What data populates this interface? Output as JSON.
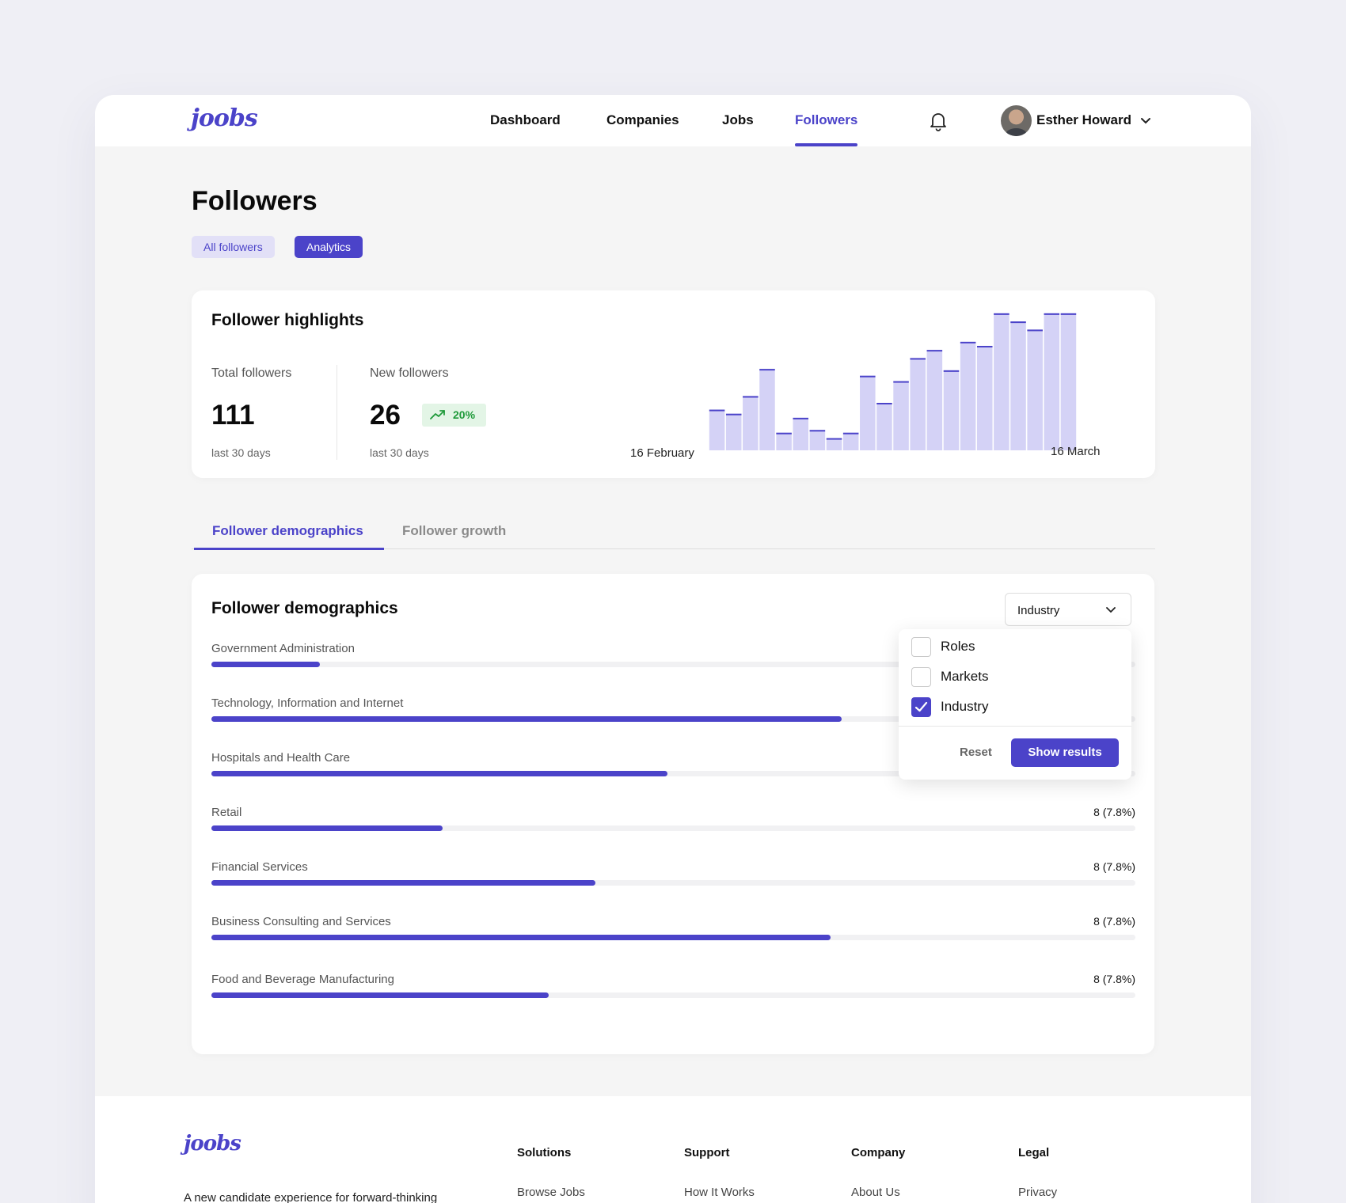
{
  "brand": {
    "name": "joobs",
    "accent": "#4b43c9"
  },
  "nav": {
    "items": [
      "Dashboard",
      "Companies",
      "Jobs",
      "Followers"
    ],
    "active": "Followers"
  },
  "user": {
    "name": "Esther Howard"
  },
  "page": {
    "title": "Followers",
    "pills": {
      "all": "All followers",
      "analytics": "Analytics",
      "active": "Analytics"
    }
  },
  "highlights": {
    "title": "Follower highlights",
    "total": {
      "label": "Total followers",
      "value": "111",
      "sub": "last 30 days"
    },
    "new": {
      "label": "New followers",
      "value": "26",
      "sub": "last 30 days",
      "growth": "20%"
    }
  },
  "chart_data": {
    "type": "bar",
    "x_start_label": "16 February",
    "x_end_label": "16 March",
    "values": [
      30,
      27,
      40,
      60,
      13,
      24,
      15,
      9,
      13,
      55,
      35,
      51,
      68,
      74,
      59,
      80,
      77,
      101,
      95,
      89,
      101,
      101
    ],
    "ylim": [
      0,
      105
    ],
    "grid": false,
    "color": "#d4d2f6",
    "cap_color": "#4b43c9"
  },
  "tabs": {
    "demographics": "Follower demographics",
    "growth": "Follower growth",
    "active": "Follower demographics"
  },
  "demographics": {
    "title": "Follower demographics",
    "filter": "Industry",
    "rows": [
      {
        "label": "Government Administration",
        "value": "",
        "fraction": 0.117
      },
      {
        "label": "Technology, Information and Internet",
        "value": "",
        "fraction": 0.682
      },
      {
        "label": "Hospitals and Health Care",
        "value": "",
        "fraction": 0.494
      },
      {
        "label": "Retail",
        "value": "8 (7.8%)",
        "fraction": 0.25
      },
      {
        "label": "Financial Services",
        "value": "8 (7.8%)",
        "fraction": 0.416
      },
      {
        "label": "Business Consulting and Services",
        "value": "8 (7.8%)",
        "fraction": 0.67
      },
      {
        "label": "Food and Beverage Manufacturing",
        "value": "8 (7.8%)",
        "fraction": 0.365
      }
    ]
  },
  "dropdown": {
    "options": [
      {
        "label": "Roles",
        "checked": false
      },
      {
        "label": "Markets",
        "checked": false
      },
      {
        "label": "Industry",
        "checked": true
      }
    ],
    "reset": "Reset",
    "show": "Show results"
  },
  "footer": {
    "tagline": "A new candidate experience for forward-thinking",
    "columns": [
      {
        "title": "Solutions",
        "link": "Browse Jobs"
      },
      {
        "title": "Support",
        "link": "How It Works"
      },
      {
        "title": "Company",
        "link": "About Us"
      },
      {
        "title": "Legal",
        "link": "Privacy"
      }
    ]
  }
}
